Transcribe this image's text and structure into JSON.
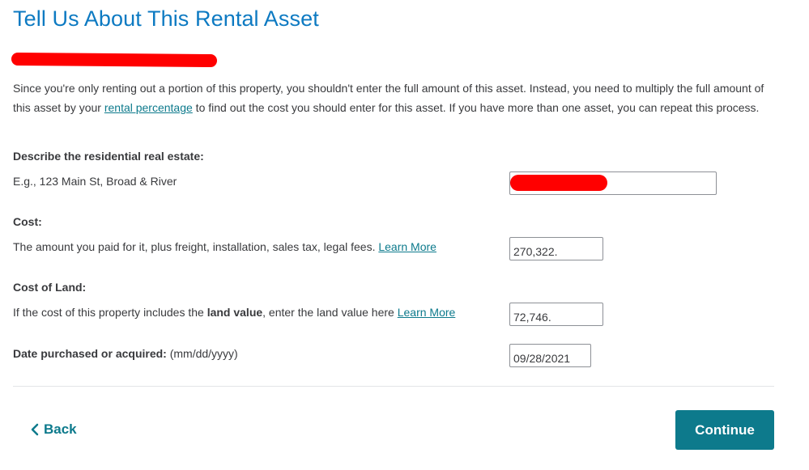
{
  "page": {
    "title": "Tell Us About This Rental Asset"
  },
  "intro": {
    "text_before_link": "Since you're only renting out a portion of this property, you shouldn't enter the full amount of this asset. Instead, you need to multiply the full amount of this asset by your ",
    "link": "rental percentage",
    "text_after_link": " to find out the cost you should enter for this asset. If you have more than one asset, you can repeat this process."
  },
  "description": {
    "label": "Describe the residential real estate:",
    "help": "E.g., 123 Main St, Broad & River",
    "value": ""
  },
  "cost": {
    "label": "Cost:",
    "help": "The amount you paid for it, plus freight, installation, sales tax, legal fees. ",
    "link": "Learn More",
    "value": "270,322."
  },
  "land": {
    "label": "Cost of Land:",
    "help_before": "If the cost of this property includes the ",
    "help_bold": "land value",
    "help_after": ", enter the land value here ",
    "link": "Learn More",
    "value": "72,746."
  },
  "date": {
    "label": "Date purchased or acquired:",
    "hint": " (mm/dd/yyyy)",
    "value": "09/28/2021"
  },
  "footer": {
    "back_label": "Back",
    "continue_label": "Continue"
  },
  "colors": {
    "title": "#0d7ac2",
    "accent": "#0d7a8c",
    "redaction": "#ff0000"
  },
  "icons": {
    "back": "chevron-left-icon"
  }
}
